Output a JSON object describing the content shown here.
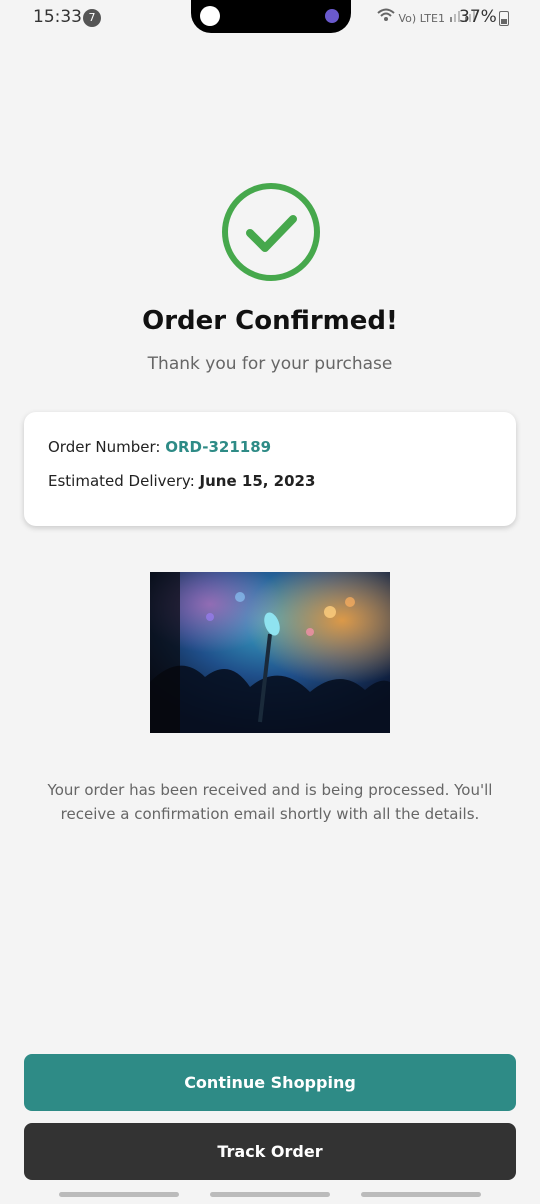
{
  "status_bar": {
    "time": "15:33",
    "notification_count": "7",
    "battery": "37%",
    "network_label": "Vo) LTE1"
  },
  "confirmation": {
    "title": "Order Confirmed!",
    "subtitle": "Thank you for your purchase"
  },
  "order_card": {
    "order_number_label": "Order Number: ",
    "order_number_value": "ORD-321189",
    "delivery_label": "Estimated Delivery: ",
    "delivery_value": "June 15, 2023"
  },
  "message": "Your order has been received and is being processed. You'll receive a confirmation email shortly with all the details.",
  "buttons": {
    "continue_label": "Continue Shopping",
    "track_label": "Track Order"
  },
  "colors": {
    "accent_teal": "#2e8b86",
    "success_green": "#46a84c",
    "dark_button": "#333333"
  },
  "icons": {
    "check": "check-circle-icon"
  }
}
